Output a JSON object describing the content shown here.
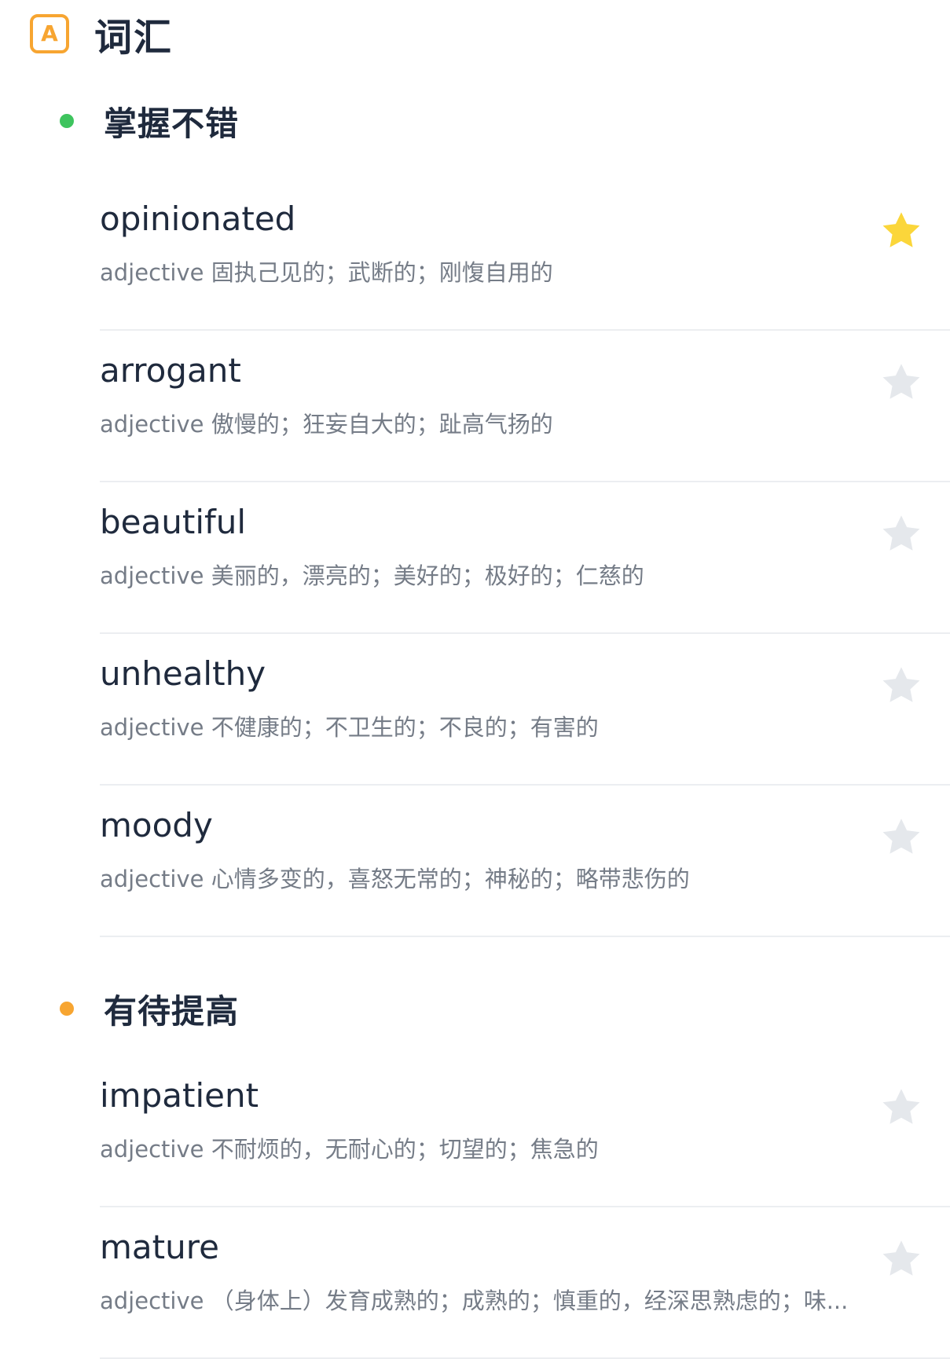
{
  "header": {
    "icon_letter": "A",
    "title": "词汇"
  },
  "colors": {
    "accent_orange": "#f7a531",
    "section_good_dot": "#3ec45e",
    "section_improve_dot": "#f7a531",
    "star_active": "#fbd63a",
    "star_inactive": "#e5e8ec"
  },
  "sections": [
    {
      "title": "掌握不错",
      "dot_color": "#3ec45e",
      "words": [
        {
          "word": "opinionated",
          "pos": "adjective",
          "definition": "固执己见的；武断的；刚愎自用的",
          "starred": true
        },
        {
          "word": "arrogant",
          "pos": "adjective",
          "definition": "傲慢的；狂妄自大的；趾高气扬的",
          "starred": false
        },
        {
          "word": "beautiful",
          "pos": "adjective",
          "definition": "美丽的，漂亮的；美好的；极好的；仁慈的",
          "starred": false
        },
        {
          "word": "unhealthy",
          "pos": "adjective",
          "definition": "不健康的；不卫生的；不良的；有害的",
          "starred": false
        },
        {
          "word": "moody",
          "pos": "adjective",
          "definition": "心情多变的，喜怒无常的；神秘的；略带悲伤的",
          "starred": false
        }
      ]
    },
    {
      "title": "有待提高",
      "dot_color": "#f7a531",
      "words": [
        {
          "word": "impatient",
          "pos": "adjective",
          "definition": "不耐烦的，无耐心的；切望的；焦急的",
          "starred": false
        },
        {
          "word": "mature",
          "pos": "adjective",
          "definition": "（身体上）发育成熟的；成熟的；慎重的，经深思熟虑的；味...",
          "starred": false
        }
      ]
    }
  ]
}
